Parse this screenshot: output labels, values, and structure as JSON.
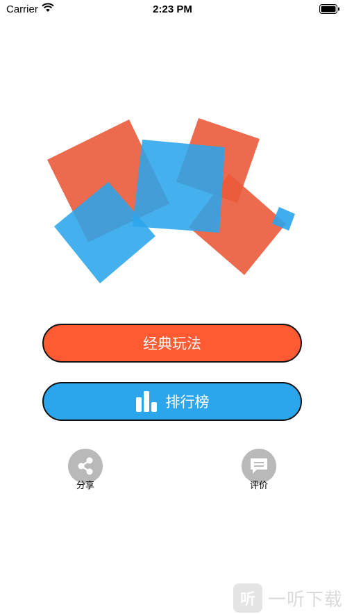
{
  "status_bar": {
    "carrier": "Carrier",
    "time": "2:23 PM"
  },
  "logo": {
    "colors": {
      "red": "#ea5a3a",
      "blue": "#2ba5ec"
    }
  },
  "buttons": {
    "classic_label": "经典玩法",
    "rank_label": "排行榜"
  },
  "actions": {
    "share_label": "分享",
    "review_label": "评价"
  },
  "watermark": {
    "badge": "听",
    "text": "一听下载"
  },
  "colors": {
    "classic_button": "#ff5a32",
    "rank_button": "#2ba5ec",
    "action_circle": "#b9b9b9"
  }
}
